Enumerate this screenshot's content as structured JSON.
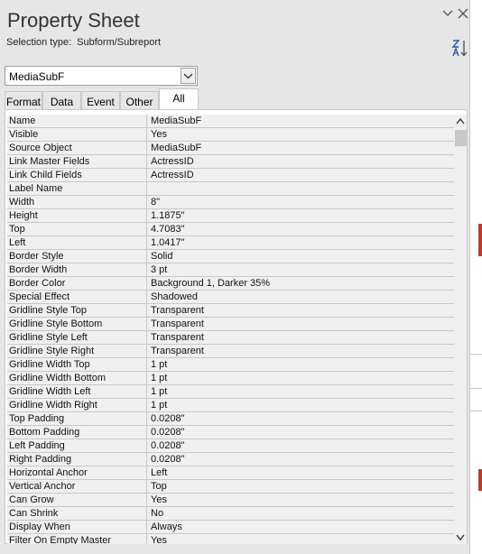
{
  "header": {
    "title": "Property Sheet",
    "selection_type_label": "Selection type:",
    "selection_type_value": "Subform/Subreport"
  },
  "selector": {
    "value": "MediaSubF"
  },
  "tabs": [
    {
      "label": "Format"
    },
    {
      "label": "Data"
    },
    {
      "label": "Event"
    },
    {
      "label": "Other"
    },
    {
      "label": "All",
      "active": true
    }
  ],
  "properties": [
    {
      "name": "Name",
      "value": "MediaSubF"
    },
    {
      "name": "Visible",
      "value": "Yes"
    },
    {
      "name": "Source Object",
      "value": "MediaSubF"
    },
    {
      "name": "Link Master Fields",
      "value": "ActressID"
    },
    {
      "name": "Link Child Fields",
      "value": "ActressID"
    },
    {
      "name": "Label Name",
      "value": ""
    },
    {
      "name": "Width",
      "value": "8\""
    },
    {
      "name": "Height",
      "value": "1.1875\""
    },
    {
      "name": "Top",
      "value": "4.7083\""
    },
    {
      "name": "Left",
      "value": "1.0417\""
    },
    {
      "name": "Border Style",
      "value": "Solid"
    },
    {
      "name": "Border Width",
      "value": "3 pt"
    },
    {
      "name": "Border Color",
      "value": "Background 1, Darker 35%"
    },
    {
      "name": "Special Effect",
      "value": "Shadowed"
    },
    {
      "name": "Gridline Style Top",
      "value": "Transparent"
    },
    {
      "name": "Gridline Style Bottom",
      "value": "Transparent"
    },
    {
      "name": "Gridline Style Left",
      "value": "Transparent"
    },
    {
      "name": "Gridline Style Right",
      "value": "Transparent"
    },
    {
      "name": "Gridline Width Top",
      "value": "1 pt"
    },
    {
      "name": "Gridline Width Bottom",
      "value": "1 pt"
    },
    {
      "name": "Gridline Width Left",
      "value": "1 pt"
    },
    {
      "name": "Gridline Width Right",
      "value": "1 pt"
    },
    {
      "name": "Top Padding",
      "value": "0.0208\""
    },
    {
      "name": "Bottom Padding",
      "value": "0.0208\""
    },
    {
      "name": "Left Padding",
      "value": "0.0208\""
    },
    {
      "name": "Right Padding",
      "value": "0.0208\""
    },
    {
      "name": "Horizontal Anchor",
      "value": "Left"
    },
    {
      "name": "Vertical Anchor",
      "value": "Top"
    },
    {
      "name": "Can Grow",
      "value": "Yes"
    },
    {
      "name": "Can Shrink",
      "value": "No"
    },
    {
      "name": "Display When",
      "value": "Always"
    },
    {
      "name": "Filter On Empty Master",
      "value": "Yes"
    }
  ],
  "icons": {
    "collapse": "chevron-down-icon",
    "close": "close-icon",
    "sort": "sort-az-icon",
    "dropdown": "chevron-down-icon",
    "scroll_up": "arrow-up-icon",
    "scroll_down": "arrow-down-icon"
  },
  "colors": {
    "pane_bg": "#e6e6e6",
    "grid_cell": "#f0f0f0",
    "grid_line": "#c8c8c8"
  }
}
